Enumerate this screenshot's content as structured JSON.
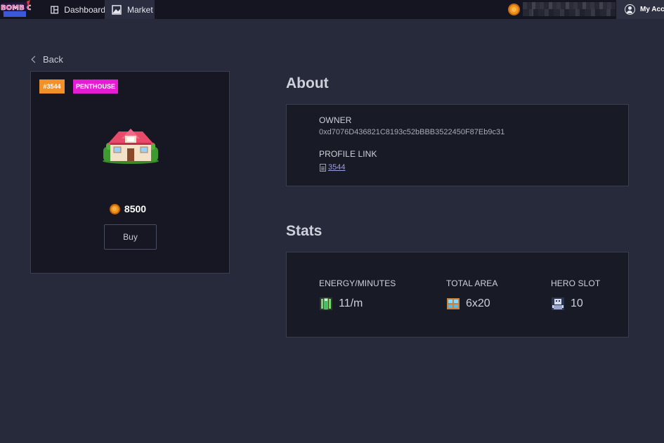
{
  "header": {
    "logo_text": "BOMB CRYPTO",
    "tabs": [
      {
        "label": "Dashboard",
        "icon": "dashboard-icon"
      },
      {
        "label": "Market",
        "icon": "market-icon",
        "active": true
      }
    ],
    "account_label": "My Acco"
  },
  "back_label": "Back",
  "item": {
    "id_badge": "#3544",
    "type_badge": "PENTHOUSE",
    "price": "8500",
    "buy_label": "Buy",
    "colors": {
      "id_badge": "#f2902a",
      "type_badge": "#e61bd4"
    }
  },
  "about": {
    "title": "About",
    "owner_label": "OWNER",
    "owner_value": "0xd7076D436821C8193c52bBBB3522450F87Eb9c31",
    "profile_label": "PROFILE LINK",
    "profile_link": "3544"
  },
  "stats": {
    "title": "Stats",
    "items": [
      {
        "label": "ENERGY/MINUTES",
        "value": "11/m",
        "icon": "battery-icon"
      },
      {
        "label": "TOTAL AREA",
        "value": "6x20",
        "icon": "window-icon"
      },
      {
        "label": "HERO SLOT",
        "value": "10",
        "icon": "robot-icon"
      }
    ]
  }
}
